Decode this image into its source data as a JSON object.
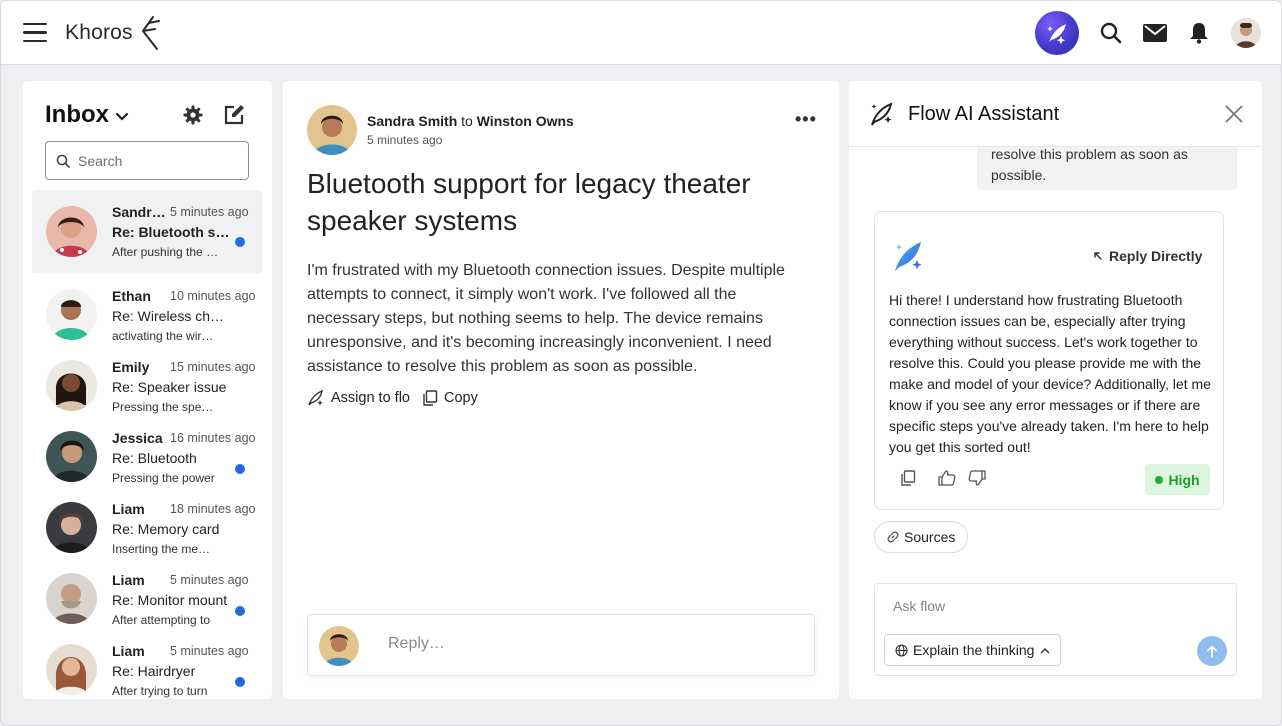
{
  "app": {
    "brand": "Khoros"
  },
  "inbox": {
    "title": "Inbox",
    "search_placeholder": "Search",
    "messages": [
      {
        "name": "Sandra Smith",
        "time": "5 minutes ago",
        "subject": "Re: Bluetooth support",
        "preview": "After pushing the button",
        "unread": true,
        "active": true,
        "avatar_color": "#d8958a"
      },
      {
        "name": "Ethan",
        "time": "10 minutes ago",
        "subject": "Re: Wireless charging",
        "preview": "activating the wireless",
        "unread": false,
        "active": false,
        "avatar_color": "#2fbf96"
      },
      {
        "name": "Emily",
        "time": "15 minutes ago",
        "subject": "Re: Speaker issue",
        "preview": "Pressing the speaker",
        "unread": false,
        "active": false,
        "avatar_color": "#caa384"
      },
      {
        "name": "Jessica",
        "time": "16 minutes ago",
        "subject": "Re: Bluetooth",
        "preview": "Pressing the power",
        "unread": true,
        "active": false,
        "avatar_color": "#4f6c6a"
      },
      {
        "name": "Liam",
        "time": "18 minutes ago",
        "subject": "Re: Memory card",
        "preview": "Inserting the memory",
        "unread": false,
        "active": false,
        "avatar_color": "#46474a"
      },
      {
        "name": "Liam",
        "time": "5 minutes ago",
        "subject": "Re: Monitor mount",
        "preview": "After attempting to",
        "unread": true,
        "active": false,
        "avatar_color": "#9d8f85"
      },
      {
        "name": "Liam",
        "time": "5 minutes ago",
        "subject": "Re: Hairdryer",
        "preview": "After trying to turn",
        "unread": true,
        "active": false,
        "avatar_color": "#b9866a"
      }
    ]
  },
  "conversation": {
    "from": "Sandra Smith",
    "to_word": "to",
    "to": "Winston Owns",
    "time": "5 minutes ago",
    "title": "Bluetooth support for legacy theater speaker systems",
    "body": "I'm frustrated with my Bluetooth connection issues. Despite multiple attempts to connect, it simply won't work. I've followed all the necessary steps, but nothing seems to help. The device remains unresponsive, and it's becoming increasingly inconvenient. I need assistance to resolve this problem as soon as possible.",
    "assign_label": "Assign to flo",
    "copy_label": "Copy",
    "reply_placeholder": "Reply…",
    "more_label": "•••"
  },
  "assistant": {
    "title": "Flow AI Assistant",
    "user_bubble": "resolve this problem as soon as possible.",
    "reply_directly": "Reply Directly",
    "response": "Hi there! I understand how frustrating Bluetooth connection issues can be, especially after trying everything without success. Let's work together to resolve this. Could you please provide me with the make and model of your device? Additionally, let me know if you see any error messages or if there are specific steps you've already taken. I'm here to help you get this sorted out!",
    "confidence": "High",
    "sources_label": "Sources",
    "ask_placeholder": "Ask flow",
    "mode_label": "Explain the thinking"
  },
  "colors": {
    "accent_blue": "#1d6ed8",
    "confidence_green": "#1e9a2e",
    "send_button": "#8fbbee"
  }
}
